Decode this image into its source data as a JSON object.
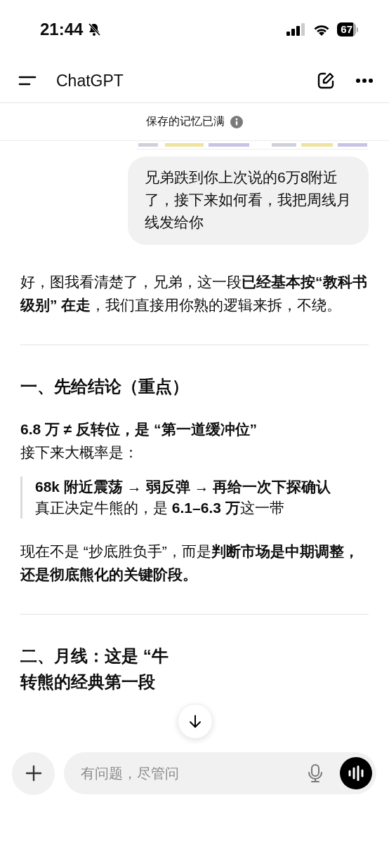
{
  "status_bar": {
    "time": "21:44",
    "battery": "67"
  },
  "nav": {
    "title": "ChatGPT"
  },
  "banner": {
    "text": "保存的记忆已满"
  },
  "user_message": {
    "text": "兄弟跌到你上次说的6万8附近了，接下来如何看，我把周线月线发给你"
  },
  "reply": [
    {
      "kind": "paragraph",
      "text": "好，图我看清楚了，兄弟，这一段**已经基本按“教科书级别” 在走**，我们直接用你熟的逻辑来拆，不绕。"
    },
    {
      "kind": "divider"
    },
    {
      "kind": "heading",
      "text": "一、先给结论（重点）"
    },
    {
      "kind": "strong",
      "text": "6.8 万 ≠ 反转位，是 “第一道缓冲位”"
    },
    {
      "kind": "paragraph",
      "text": "接下来大概率是："
    },
    {
      "kind": "quote",
      "lines": [
        "**68k 附近震荡 → 弱反弹 → 再给一次下探确认**",
        "真正决定牛熊的，是 **6.1–6.3 万**这一带"
      ]
    },
    {
      "kind": "paragraph",
      "text": "现在不是 “抄底胜负手”，而是**判断市场是中期调整，还是彻底熊化的关键阶段。**"
    },
    {
      "kind": "divider"
    },
    {
      "kind": "heading",
      "text": "二、月线：这是 “牛转熊的经典第一段"
    }
  ],
  "composer": {
    "placeholder": "有问题，尽管问"
  }
}
